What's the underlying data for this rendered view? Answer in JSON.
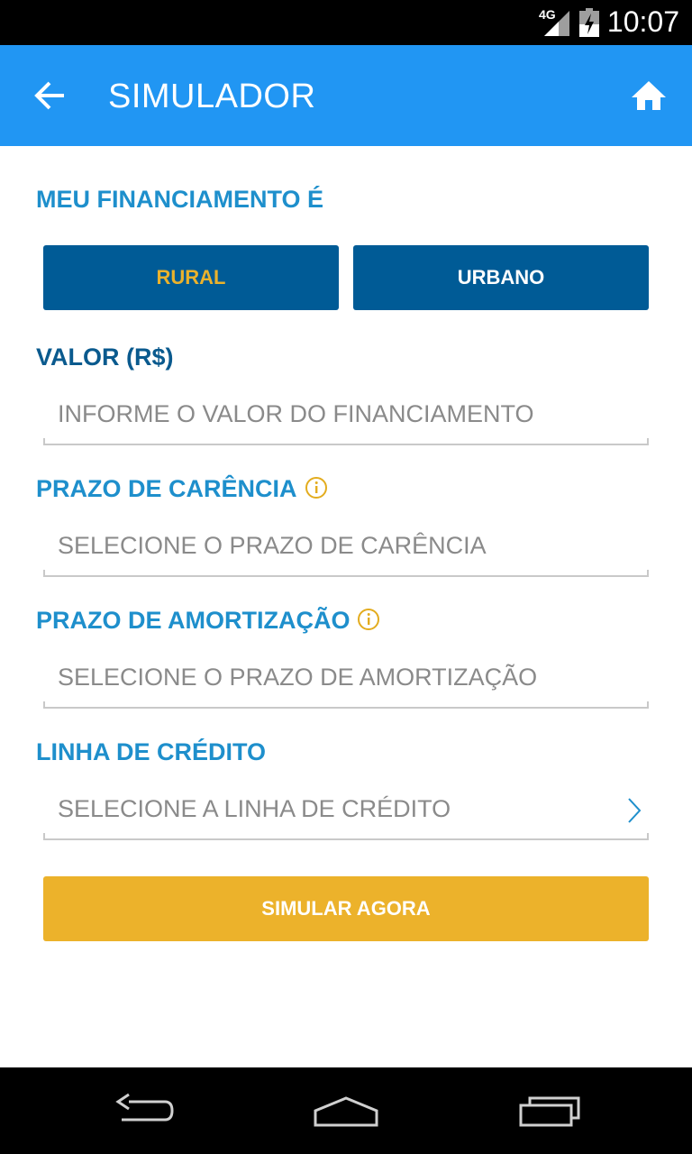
{
  "status_bar": {
    "time": "10:07",
    "network": "4G"
  },
  "app_bar": {
    "title": "SIMULADOR",
    "back_icon": "arrow-left-icon",
    "home_icon": "home-icon",
    "background_color": "#2196f3"
  },
  "form": {
    "financing_type_label": "MEU FINANCIAMENTO É",
    "financing_type_options": [
      {
        "label": "RURAL",
        "selected": true
      },
      {
        "label": "URBANO",
        "selected": false
      }
    ],
    "value_label": "VALOR (R$)",
    "value_placeholder": "INFORME O VALOR DO FINANCIAMENTO",
    "grace_label": "PRAZO DE CARÊNCIA",
    "grace_placeholder": "SELECIONE O PRAZO DE CARÊNCIA",
    "amortization_label": "PRAZO DE AMORTIZAÇÃO",
    "amortization_placeholder": "SELECIONE O PRAZO DE AMORTIZAÇÃO",
    "credit_line_label": "LINHA DE CRÉDITO",
    "credit_line_placeholder": "SELECIONE A LINHA DE CRÉDITO",
    "submit_label": "SIMULAR AGORA"
  },
  "colors": {
    "accent_blue": "#1e8fcc",
    "dark_blue": "#005b96",
    "gold": "#ecb22b"
  }
}
